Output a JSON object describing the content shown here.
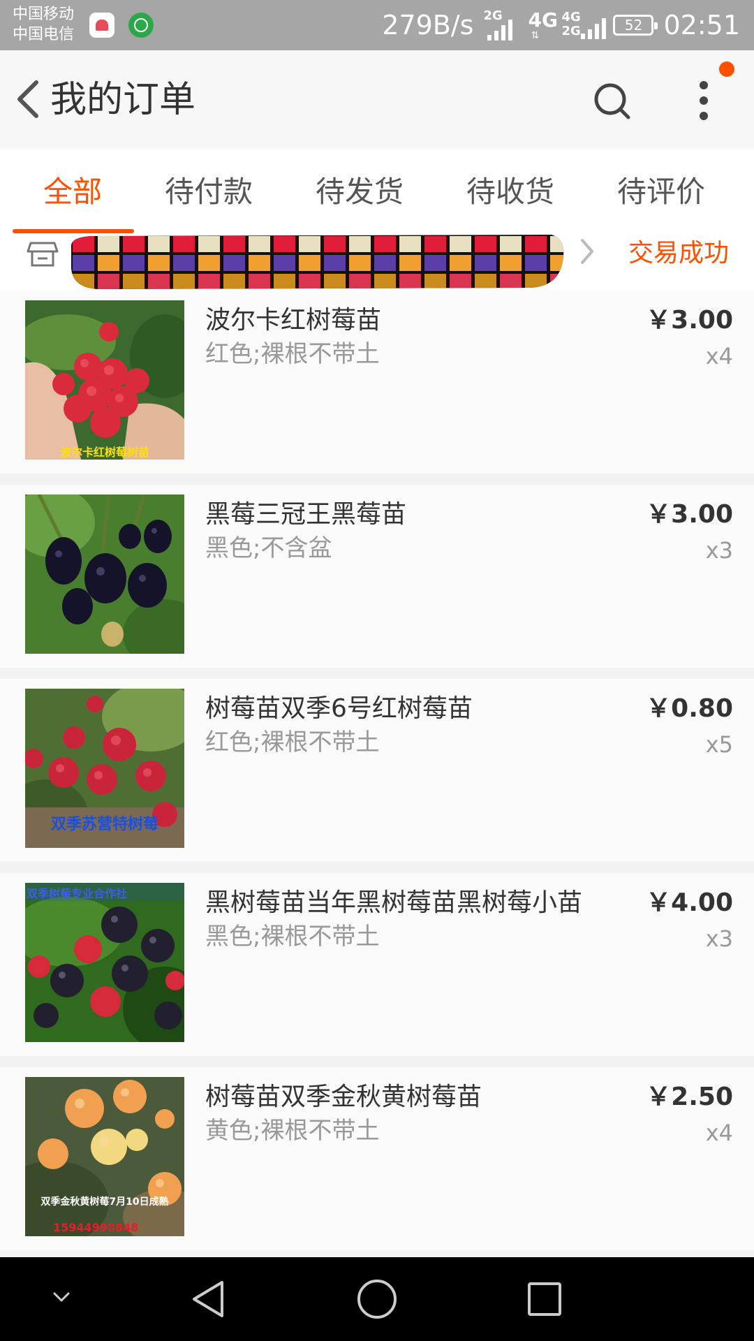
{
  "status_bar": {
    "carrier1": "中国移动",
    "carrier2": "中国电信",
    "speed": "279B/s",
    "net1": "2G",
    "net2": "4G",
    "net3": "4G",
    "net4": "2G",
    "battery": "52",
    "time": "02:51"
  },
  "header": {
    "title": "我的订单"
  },
  "tabs": [
    {
      "label": "全部"
    },
    {
      "label": "待付款"
    },
    {
      "label": "待发货"
    },
    {
      "label": "待收货"
    },
    {
      "label": "待评价"
    }
  ],
  "order": {
    "status": "交易成功"
  },
  "items": [
    {
      "title": "波尔卡红树莓苗",
      "spec": "红色;裸根不带土",
      "price": "￥3.00",
      "qty": "x4",
      "thumb_caption": "波尔卡红树莓树苗"
    },
    {
      "title": "黑莓三冠王黑莓苗",
      "spec": "黑色;不含盆",
      "price": "￥3.00",
      "qty": "x3"
    },
    {
      "title": "树莓苗双季6号红树莓苗",
      "spec": "红色;裸根不带土",
      "price": "￥0.80",
      "qty": "x5",
      "thumb_caption": "双季苏营特树莓"
    },
    {
      "title": "黑树莓苗当年黑树莓苗黑树莓小苗",
      "spec": "黑色;裸根不带土",
      "price": "￥4.00",
      "qty": "x3",
      "thumb_caption": "双季树莓专业合作社"
    },
    {
      "title": "树莓苗双季金秋黄树莓苗",
      "spec": "黄色;裸根不带土",
      "price": "￥2.50",
      "qty": "x4",
      "thumb_caption": "双季金秋黄树莓7月10日成熟",
      "thumb_phone": "15944998848"
    }
  ],
  "colors": {
    "accent": "#ff5000",
    "status_bar": "#a6a6a6",
    "nav_bar": "#000000"
  },
  "icons": [
    "back-icon",
    "search-icon",
    "more-icon",
    "shop-icon",
    "chevron-right-icon",
    "nav-down-icon",
    "nav-back-icon",
    "nav-home-icon",
    "nav-recents-icon"
  ]
}
